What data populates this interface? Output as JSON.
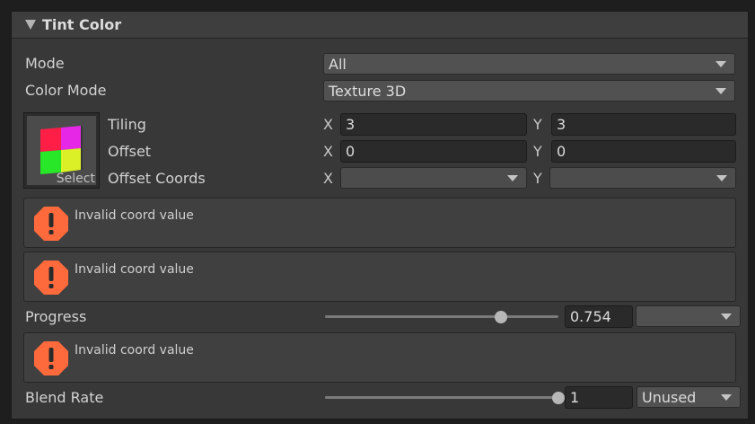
{
  "section": {
    "title": "Tint Color"
  },
  "mode": {
    "label": "Mode",
    "value": "All"
  },
  "color_mode": {
    "label": "Color Mode",
    "value": "Texture 3D"
  },
  "texture": {
    "select_label": "Select",
    "tiling": {
      "label": "Tiling",
      "x_label": "X",
      "x": "3",
      "y_label": "Y",
      "y": "3"
    },
    "offset": {
      "label": "Offset",
      "x_label": "X",
      "x": "0",
      "y_label": "Y",
      "y": "0"
    },
    "offset_coords": {
      "label": "Offset Coords",
      "x_label": "X",
      "x": "",
      "y_label": "Y",
      "y": ""
    }
  },
  "warnings": [
    {
      "text": "Invalid coord value"
    },
    {
      "text": "Invalid coord value"
    },
    {
      "text": "Invalid coord value"
    }
  ],
  "progress": {
    "label": "Progress",
    "value": "0.754",
    "fraction": 0.754,
    "mode": ""
  },
  "blend_rate": {
    "label": "Blend Rate",
    "value": "1",
    "fraction": 1.0,
    "mode": "Unused"
  },
  "colors": {
    "warning": "#ff6a3d",
    "background": "#383838",
    "field": "#2a2a2a"
  }
}
